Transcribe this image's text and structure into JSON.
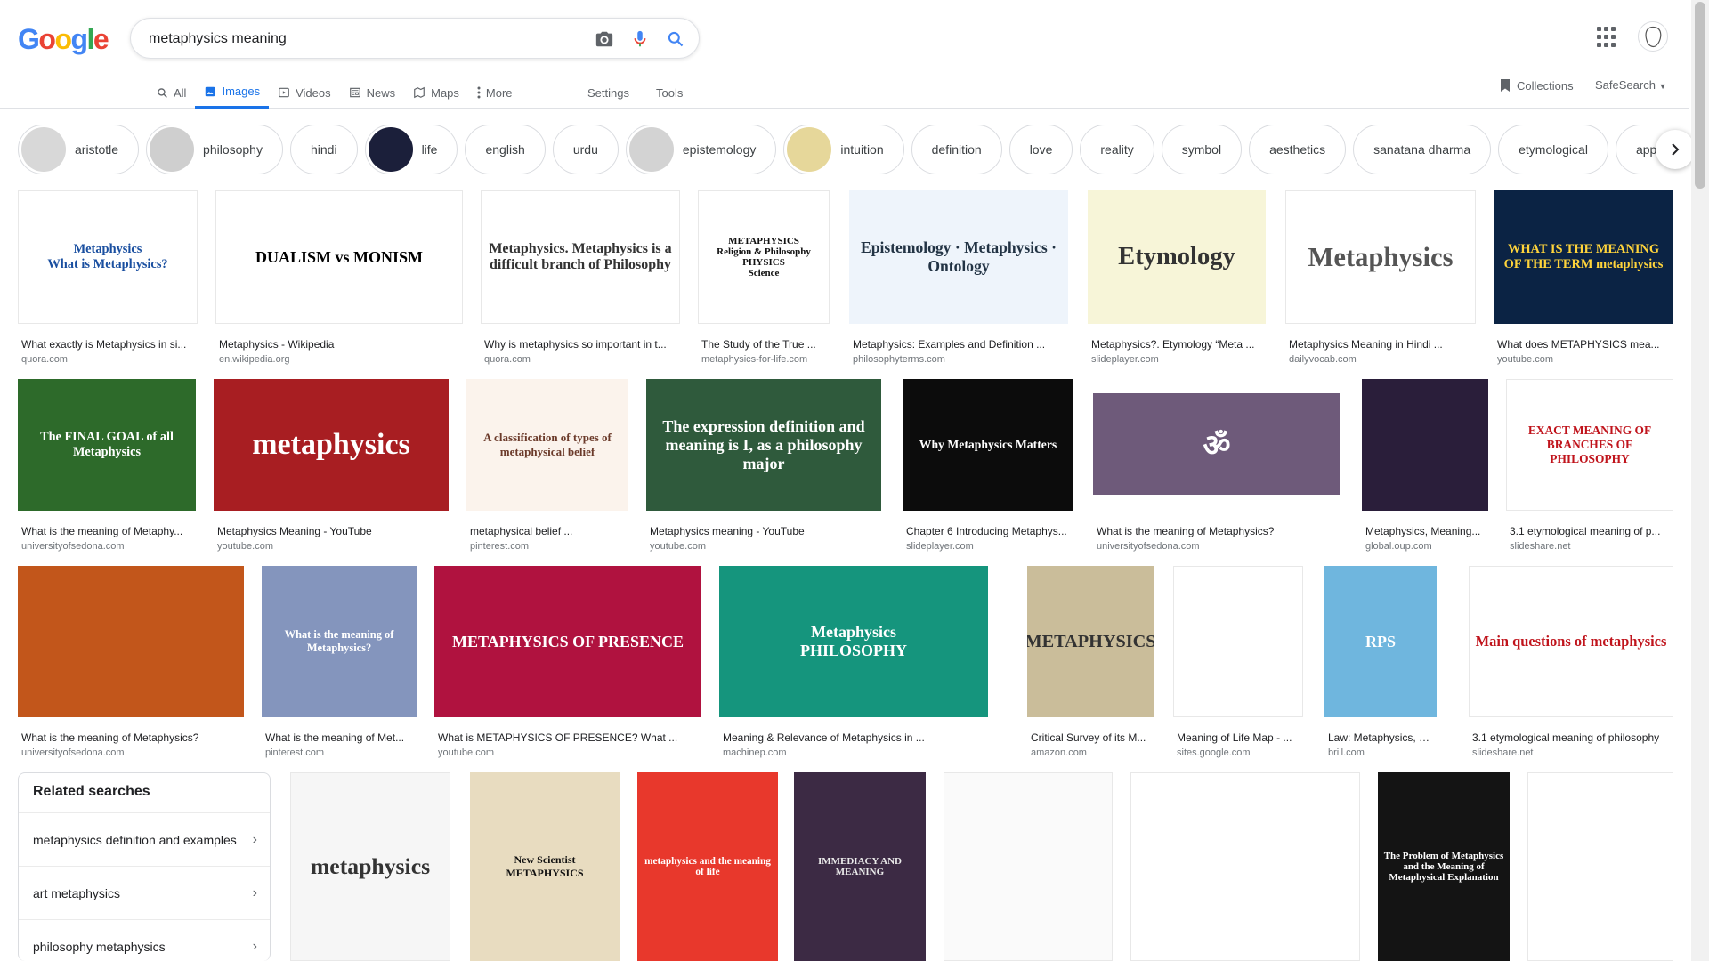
{
  "search": {
    "query": "metaphysics meaning"
  },
  "tabs": [
    {
      "label": "All",
      "icon": "search-icon"
    },
    {
      "label": "Images",
      "icon": "image-icon",
      "active": true
    },
    {
      "label": "Videos",
      "icon": "video-icon"
    },
    {
      "label": "News",
      "icon": "news-icon"
    },
    {
      "label": "Maps",
      "icon": "map-icon"
    },
    {
      "label": "More",
      "icon": "more-vert-icon"
    }
  ],
  "links": {
    "settings": "Settings",
    "tools": "Tools",
    "collections": "Collections",
    "safesearch": "SafeSearch"
  },
  "chips": [
    {
      "label": "aristotle",
      "thumb": "#d8d8d8"
    },
    {
      "label": "philosophy",
      "thumb": "#cfcfcf"
    },
    {
      "label": "hindi"
    },
    {
      "label": "life",
      "thumb": "#1b1f3a"
    },
    {
      "label": "english"
    },
    {
      "label": "urdu"
    },
    {
      "label": "epistemology",
      "thumb": "#d3d3d3"
    },
    {
      "label": "intuition",
      "thumb": "#e6d79a"
    },
    {
      "label": "definition"
    },
    {
      "label": "love"
    },
    {
      "label": "reality"
    },
    {
      "label": "symbol"
    },
    {
      "label": "aesthetics"
    },
    {
      "label": "sanatana dharma"
    },
    {
      "label": "etymological"
    },
    {
      "label": "appearance"
    }
  ],
  "colors": {
    "accent": "#1a73e8",
    "link_gray": "#5f6368",
    "source_gray": "#70757a"
  },
  "results": [
    {
      "title": "What exactly is Metaphysics in si...",
      "source": "quora.com",
      "thumb_text": "Metaphysics\nWhat is Metaphysics?",
      "bg": "#ffffff",
      "fg": "#1a4fa0"
    },
    {
      "title": "Metaphysics - Wikipedia",
      "source": "en.wikipedia.org",
      "thumb_text": "DUALISM vs MONISM",
      "bg": "#ffffff",
      "fg": "#000000"
    },
    {
      "title": "Why is metaphysics so important in t...",
      "source": "quora.com",
      "thumb_text": "Metaphysics. Metaphysics is a difficult branch of Philosophy",
      "bg": "#ffffff",
      "fg": "#333333"
    },
    {
      "title": "The Study of the True ...",
      "source": "metaphysics-for-life.com",
      "thumb_text": "METAPHYSICS\nReligion & Philosophy\nPHYSICS\nScience",
      "bg": "#ffffff",
      "fg": "#111111"
    },
    {
      "title": "Metaphysics: Examples and Definition ...",
      "source": "philosophyterms.com",
      "thumb_text": "Epistemology · Metaphysics · Ontology",
      "bg": "#eef4fb",
      "fg": "#234"
    },
    {
      "title": "Metaphysics?. Etymology “Meta ...",
      "source": "slideplayer.com",
      "thumb_text": "Etymology",
      "bg": "#f7f5d8",
      "fg": "#333"
    },
    {
      "title": "Metaphysics Meaning in Hindi ...",
      "source": "dailyvocab.com",
      "thumb_text": "Metaphysics",
      "bg": "#ffffff",
      "fg": "#555"
    },
    {
      "title": "What does METAPHYSICS mea...",
      "source": "youtube.com",
      "thumb_text": "WHAT IS THE MEANING OF THE TERM metaphysics",
      "bg": "#0b2344",
      "fg": "#ffd43b"
    },
    {
      "title": "What is the meaning of Metaphy...",
      "source": "universityofsedona.com",
      "thumb_text": "The FINAL GOAL of all Metaphysics",
      "bg": "#2d6a2a",
      "fg": "#ffffff"
    },
    {
      "title": "Metaphysics Meaning - YouTube",
      "source": "youtube.com",
      "thumb_text": "metaphysics",
      "bg": "#a81e22",
      "fg": "#ffffff"
    },
    {
      "title": "metaphysical belief ...",
      "source": "pinterest.com",
      "thumb_text": "A classification of types of metaphysical belief",
      "bg": "#fbf3ec",
      "fg": "#6b3a2a"
    },
    {
      "title": "Metaphysics meaning - YouTube",
      "source": "youtube.com",
      "thumb_text": "The expression definition and meaning is I, as a philosophy major",
      "bg": "#2f5a3c",
      "fg": "#ffffff"
    },
    {
      "title": "Chapter 6 Introducing Metaphys...",
      "source": "slideplayer.com",
      "thumb_text": "Why Metaphysics Matters",
      "bg": "#0c0c0c",
      "fg": "#ffffff"
    },
    {
      "title": "What is the meaning of Metaphysics?",
      "source": "universityofsedona.com",
      "thumb_text": "ॐ",
      "bg": "#6e5a7a",
      "fg": "#ffffff"
    },
    {
      "title": "Metaphysics, Meaning...",
      "source": "global.oup.com",
      "thumb_text": "",
      "bg": "#2a1e3a",
      "fg": "#ff5fb0"
    },
    {
      "title": "3.1 etymological meaning of p...",
      "source": "slideshare.net",
      "thumb_text": "EXACT MEANING OF BRANCHES OF PHILOSOPHY",
      "bg": "#ffffff",
      "fg": "#c0141c"
    },
    {
      "title": "What is the meaning of Metaphysics?",
      "source": "universityofsedona.com",
      "thumb_text": "",
      "bg": "#c2561b",
      "fg": "#ffffff"
    },
    {
      "title": "What is the meaning of Met...",
      "source": "pinterest.com",
      "thumb_text": "What is the meaning of Metaphysics?",
      "bg": "#8495bd",
      "fg": "#ffffff"
    },
    {
      "title": "What is METAPHYSICS OF PRESENCE? What ...",
      "source": "youtube.com",
      "thumb_text": "METAPHYSICS OF PRESENCE",
      "bg": "#b0123f",
      "fg": "#ffffff"
    },
    {
      "title": "Meaning & Relevance of Metaphysics in ...",
      "source": "machinep.com",
      "thumb_text": "Metaphysics\nPHILOSOPHY",
      "bg": "#15957d",
      "fg": "#ffffff"
    },
    {
      "title": "Critical Survey of its M...",
      "source": "amazon.com",
      "thumb_text": "METAPHYSICS",
      "bg": "#cabd9a",
      "fg": "#333"
    },
    {
      "title": "Meaning of Life Map - ...",
      "source": "sites.google.com",
      "thumb_text": "",
      "bg": "#ffffff",
      "fg": "#555"
    },
    {
      "title": "Law: Metaphysics, Me...",
      "source": "brill.com",
      "thumb_text": "RPS",
      "bg": "#6fb6de",
      "fg": "#ffffff"
    },
    {
      "title": "3.1 etymological meaning of philosophy",
      "source": "slideshare.net",
      "thumb_text": "Main questions of metaphysics",
      "bg": "#ffffff",
      "fg": "#c0141c"
    },
    {
      "title": "",
      "source": "",
      "thumb_text": "metaphysics",
      "bg": "#f6f6f6",
      "fg": "#333"
    },
    {
      "title": "",
      "source": "",
      "thumb_text": "New Scientist\nMETAPHYSICS",
      "bg": "#e8dcc0",
      "fg": "#111"
    },
    {
      "title": "",
      "source": "",
      "thumb_text": "metaphysics and the meaning of life",
      "bg": "#e8382c",
      "fg": "#ffffff"
    },
    {
      "title": "",
      "source": "",
      "thumb_text": "IMMEDIACY AND MEANING",
      "bg": "#3c2a44",
      "fg": "#eaeaea"
    },
    {
      "title": "",
      "source": "",
      "thumb_text": "",
      "bg": "#fafafa",
      "fg": "#555"
    },
    {
      "title": "",
      "source": "",
      "thumb_text": "",
      "bg": "#ffffff",
      "fg": "#555"
    },
    {
      "title": "",
      "source": "",
      "thumb_text": "The Problem of Metaphysics and the Meaning of Metaphysical Explanation",
      "bg": "#141414",
      "fg": "#ffffff"
    },
    {
      "title": "",
      "source": "",
      "thumb_text": "",
      "bg": "#ffffff",
      "fg": "#555"
    }
  ],
  "related": {
    "title": "Related searches",
    "items": [
      {
        "label": "metaphysics definition and examples"
      },
      {
        "label": "art metaphysics"
      },
      {
        "label": "philosophy metaphysics"
      }
    ]
  }
}
